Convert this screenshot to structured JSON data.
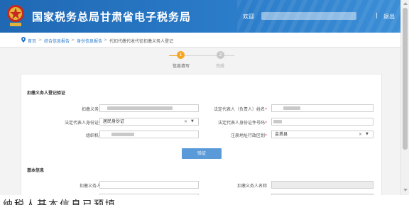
{
  "header": {
    "site_title": "国家税务总局甘肃省电子税务局",
    "welcome": "欢迎",
    "separator": "|",
    "logout": "退出"
  },
  "breadcrumb": {
    "items": [
      "首页",
      "综合信息报告",
      "身份信息报告",
      "代扣代缴代收代征扣缴义务人登记"
    ],
    "separator": ">"
  },
  "steps": [
    {
      "number": "1",
      "label": "信息填写",
      "active": true
    },
    {
      "number": "2",
      "label": "完成",
      "active": false
    }
  ],
  "section1": {
    "title": "扣缴义务人登记验证",
    "fields": {
      "withholder_name": {
        "label": "扣缴义务人名称",
        "required": "*"
      },
      "legal_rep_name": {
        "label": "法定代表人（负责人）姓名",
        "required": "*"
      },
      "legal_rep_id_type": {
        "label": "法定代表人身份证件种类",
        "required": "*",
        "value": "居民身份证",
        "clear": "×",
        "caret": "▼"
      },
      "legal_rep_id_number": {
        "label": "法定代表人身份证件号码",
        "required": "*"
      },
      "org_code": {
        "label": "组织机构代码",
        "required": "*"
      },
      "register_region": {
        "label": "注册地址行政区划",
        "required": "*",
        "value": "金塔县",
        "clear": "×",
        "caret": "▼"
      }
    },
    "verify_button": "验证"
  },
  "section2": {
    "title": "基本信息",
    "fields": {
      "withholder_id": {
        "label": "扣缴义务人识别号",
        "required": ""
      },
      "withholder_name": {
        "label": "扣缴义务人名称",
        "required": ""
      }
    }
  },
  "bottom_caption": "纳税人基本信息已预填",
  "colors": {
    "header_blue": "#2068b4",
    "step_active": "#f5a623",
    "step_inactive": "#c8c8c8",
    "button": "#5b9ad9",
    "required": "#e84a4a",
    "link": "#2a78c9"
  }
}
